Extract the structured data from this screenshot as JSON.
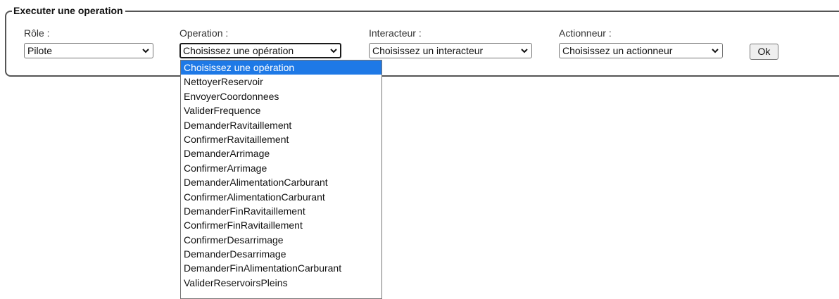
{
  "form": {
    "legend": "Executer une operation",
    "role": {
      "label": "Rôle :",
      "value": "Pilote"
    },
    "operation": {
      "label": "Operation :",
      "value": "Choisissez une opération"
    },
    "interacteur": {
      "label": "Interacteur :",
      "value": "Choisissez un interacteur"
    },
    "actionneur": {
      "label": "Actionneur :",
      "value": "Choisissez un actionneur"
    },
    "ok_label": "Ok"
  },
  "operation_dropdown": {
    "selected_index": 0,
    "options": [
      "Choisissez une opération",
      "NettoyerReservoir",
      "EnvoyerCoordonnees",
      "ValiderFrequence",
      "DemanderRavitaillement",
      "ConfirmerRavitaillement",
      "DemanderArrimage",
      "ConfirmerArrimage",
      "DemanderAlimentationCarburant",
      "ConfirmerAlimentationCarburant",
      "DemanderFinRavitaillement",
      "ConfirmerFinRavitaillement",
      "ConfirmerDesarrimage",
      "DemanderDesarrimage",
      "DemanderFinAlimentationCarburant",
      "ValiderReservoirsPleins"
    ]
  },
  "icons": {
    "select_arrow": "chevron-down-icon"
  },
  "colors": {
    "selected_option_bg": "#1e79e6",
    "border": "#555555"
  }
}
